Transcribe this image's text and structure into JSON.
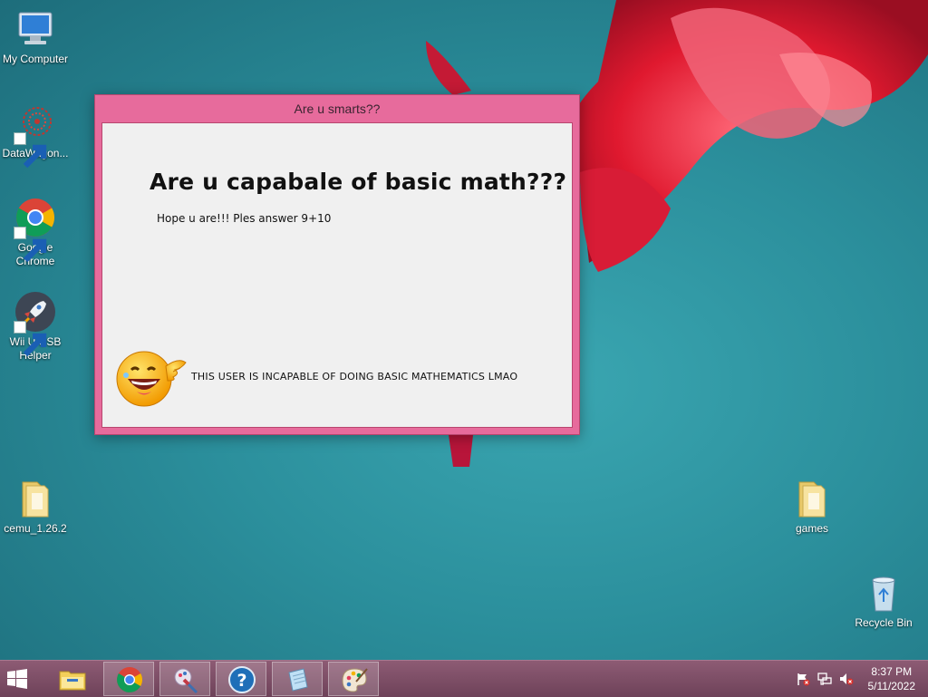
{
  "desktop": {
    "icons": [
      {
        "label": "My Computer",
        "icon": "computer-icon"
      },
      {
        "label": "DataWagon...",
        "icon": "datawagon-icon"
      },
      {
        "label": "Google Chrome",
        "icon": "chrome-icon"
      },
      {
        "label": "Wii U USB Helper",
        "icon": "rocket-icon"
      },
      {
        "label": "cemu_1.26.2",
        "icon": "folder-icon"
      },
      {
        "label": "games",
        "icon": "folder-icon"
      },
      {
        "label": "Recycle Bin",
        "icon": "recycle-bin-icon"
      }
    ]
  },
  "dialog": {
    "title": "Are u smarts??",
    "headline": "Are u capabale of basic math???",
    "prompt": "Hope u are!!! Ples answer 9+10",
    "verdict": "THIS USER IS INCAPABLE OF DOING BASIC MATHEMATICS LMAO",
    "emoji": "laughing-emoji-icon"
  },
  "taskbar": {
    "start": "windows-start-icon",
    "pinned": [
      "file-explorer-icon",
      "chrome-icon",
      "paint-brush-icon",
      "help-icon",
      "notepad-icon",
      "palette-icon"
    ],
    "tray": [
      "action-center-flag-icon",
      "network-icon",
      "volume-muted-icon"
    ],
    "time": "8:37 PM",
    "date": "5/11/2022"
  },
  "colors": {
    "dialog_frame": "#e76b9c",
    "dialog_body": "#f0f0f0",
    "taskbar": "#7a4c64",
    "desktop": "#2b8f9c"
  }
}
